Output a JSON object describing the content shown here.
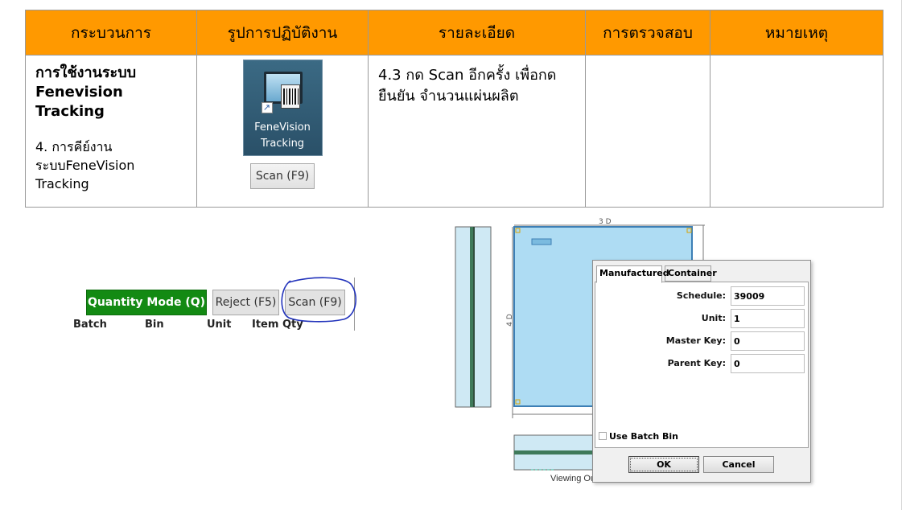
{
  "table": {
    "headers": [
      "กระบวนการ",
      "รูปการปฏิบัติงาน",
      "รายละเอียด",
      "การตรวจสอบ",
      "หมายเหตุ"
    ],
    "row": {
      "process_title": [
        "การใช้งานระบบ",
        "Fenevision",
        "Tracking"
      ],
      "process_step": [
        "4. การคีย์งาน",
        "ระบบFeneVision",
        "Tracking"
      ],
      "app_icon_label": [
        "FeneVision",
        "Tracking"
      ],
      "scan_button": "Scan (F9)",
      "detail": [
        "4.3 กด Scan อีกครั้ง เพื่อกด",
        "ยืนยัน จำนวนแผ่นผลิต"
      ],
      "inspection": "",
      "remark": ""
    },
    "header_color": "#ff9900"
  },
  "toolbar": {
    "quantity_mode": "Quantity Mode (Q)",
    "reject": "Reject (F5)",
    "scan": "Scan (F9)",
    "columns": [
      "Batch",
      "Bin",
      "Unit",
      "Item Qty"
    ],
    "highlight_color": "#2233bb"
  },
  "drawing": {
    "top_dim": "3 D",
    "side_dim": "4 D",
    "caption": "Viewing Outside"
  },
  "dialog": {
    "tabs": [
      "Manufactured",
      "Container"
    ],
    "active_tab": "Manufactured",
    "fields": [
      {
        "label": "Schedule:",
        "value": "39009"
      },
      {
        "label": "Unit:",
        "value": "1"
      },
      {
        "label": "Master Key:",
        "value": "0"
      },
      {
        "label": "Parent Key:",
        "value": "0"
      }
    ],
    "checkbox_label": "Use Batch Bin",
    "ok": "OK",
    "cancel": "Cancel"
  }
}
